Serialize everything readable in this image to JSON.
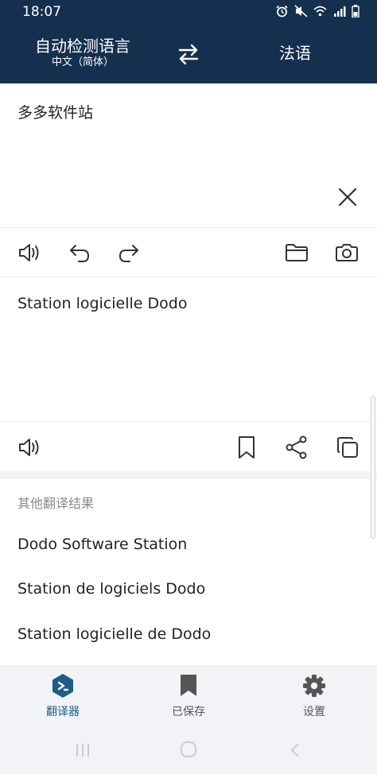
{
  "status_bar": {
    "time": "18:07",
    "icons": [
      "alarm-icon",
      "mute-icon",
      "wifi-icon",
      "signal-icon",
      "battery-icon"
    ]
  },
  "header": {
    "source_language": "自动检测语言",
    "source_language_detected": "中文（简体）",
    "target_language": "法语",
    "swap_icon": "swap-arrows-icon"
  },
  "input": {
    "text": "多多软件站",
    "clear_icon": "close-icon",
    "toolbar_icons": [
      "speaker-icon",
      "undo-icon",
      "redo-icon",
      "folder-icon",
      "camera-icon"
    ]
  },
  "output": {
    "text": "Station logicielle Dodo",
    "toolbar_icons": [
      "speaker-icon",
      "bookmark-icon",
      "share-icon",
      "copy-icon"
    ]
  },
  "alternatives": {
    "header": "其他翻译结果",
    "items": [
      "Dodo Software Station",
      "Station de logiciels Dodo",
      "Station logicielle de Dodo"
    ]
  },
  "bottom_nav": {
    "items": [
      {
        "label": "翻译器",
        "icon": "translator-icon",
        "active": true
      },
      {
        "label": "已保存",
        "icon": "bookmark-icon",
        "active": false
      },
      {
        "label": "设置",
        "icon": "gear-icon",
        "active": false
      }
    ]
  },
  "colors": {
    "header_bg": "#15304f",
    "accent": "#1b5d8a",
    "icon_gray": "#333333",
    "nav_bg": "#f2f3f6"
  }
}
